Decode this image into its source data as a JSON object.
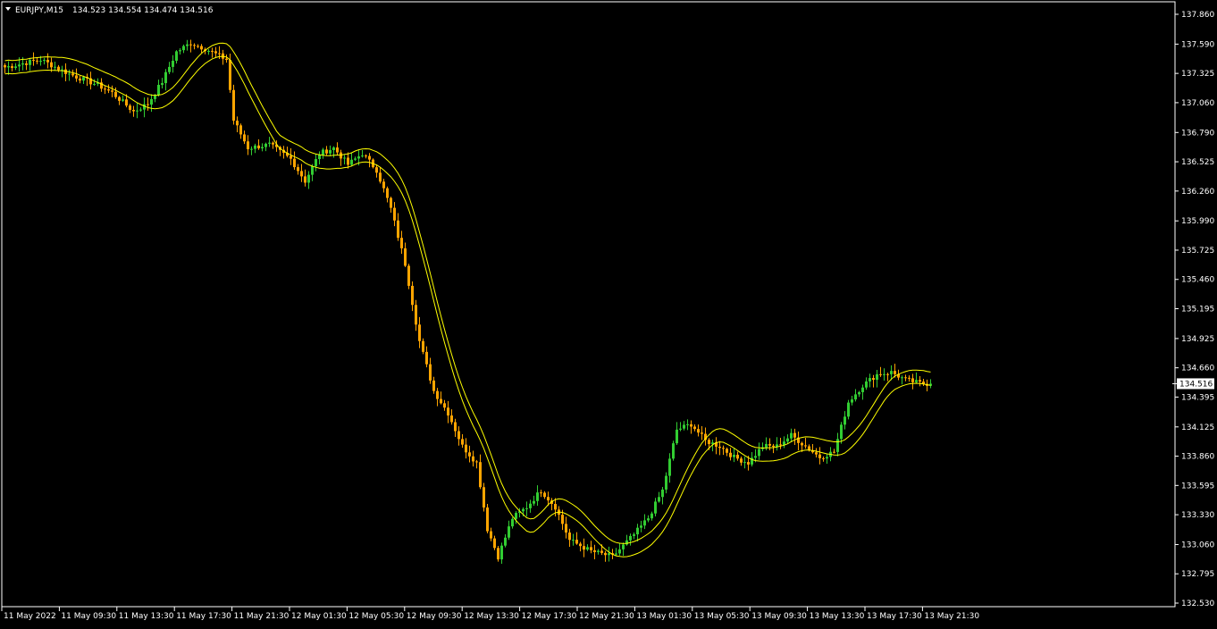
{
  "header": {
    "symbol_timeframe": "EURJPY,M15",
    "ohlc": "134.523 134.554 134.474 134.516"
  },
  "colors": {
    "background": "#000000",
    "frame": "#ffffff",
    "bull": "#32cd32",
    "bear": "#ffa500",
    "envelope": "#ffff00",
    "price_label_bg": "#ffffff",
    "price_label_fg": "#000000"
  },
  "chart_data": {
    "type": "candlestick",
    "title": "EURJPY,M15",
    "y_ticks": [
      "137.860",
      "137.590",
      "137.325",
      "137.060",
      "136.790",
      "136.525",
      "136.260",
      "135.990",
      "135.725",
      "135.460",
      "135.195",
      "134.925",
      "134.660",
      "134.395",
      "134.125",
      "133.860",
      "133.595",
      "133.330",
      "133.060",
      "132.795",
      "132.530"
    ],
    "x_ticks": [
      "11 May 2022",
      "11 May 09:30",
      "11 May 13:30",
      "11 May 17:30",
      "11 May 21:30",
      "12 May 01:30",
      "12 May 05:30",
      "12 May 09:30",
      "12 May 13:30",
      "12 May 17:30",
      "12 May 21:30",
      "13 May 01:30",
      "13 May 05:30",
      "13 May 09:30",
      "13 May 13:30",
      "13 May 17:30",
      "13 May 21:30"
    ],
    "ylim": [
      132.53,
      137.86
    ],
    "current_price": "134.516",
    "grid": false,
    "candle_count": 260,
    "path_anchors": [
      [
        0,
        137.38
      ],
      [
        10,
        137.45
      ],
      [
        18,
        137.32
      ],
      [
        26,
        137.22
      ],
      [
        30,
        137.15
      ],
      [
        36,
        136.98
      ],
      [
        40,
        137.05
      ],
      [
        44,
        137.25
      ],
      [
        48,
        137.52
      ],
      [
        52,
        137.6
      ],
      [
        56,
        137.55
      ],
      [
        62,
        137.45
      ],
      [
        64,
        136.9
      ],
      [
        68,
        136.65
      ],
      [
        74,
        136.68
      ],
      [
        80,
        136.55
      ],
      [
        84,
        136.35
      ],
      [
        88,
        136.6
      ],
      [
        92,
        136.65
      ],
      [
        96,
        136.5
      ],
      [
        100,
        136.6
      ],
      [
        104,
        136.45
      ],
      [
        108,
        136.1
      ],
      [
        112,
        135.6
      ],
      [
        116,
        134.9
      ],
      [
        120,
        134.45
      ],
      [
        124,
        134.25
      ],
      [
        128,
        133.95
      ],
      [
        132,
        133.8
      ],
      [
        135,
        133.2
      ],
      [
        138,
        132.95
      ],
      [
        142,
        133.3
      ],
      [
        146,
        133.4
      ],
      [
        150,
        133.55
      ],
      [
        154,
        133.4
      ],
      [
        158,
        133.1
      ],
      [
        164,
        133.0
      ],
      [
        170,
        132.95
      ],
      [
        176,
        133.15
      ],
      [
        180,
        133.3
      ],
      [
        184,
        133.55
      ],
      [
        188,
        134.1
      ],
      [
        192,
        134.15
      ],
      [
        196,
        134.0
      ],
      [
        200,
        133.95
      ],
      [
        204,
        133.85
      ],
      [
        208,
        133.8
      ],
      [
        212,
        133.95
      ],
      [
        216,
        133.95
      ],
      [
        220,
        134.05
      ],
      [
        224,
        133.95
      ],
      [
        228,
        133.85
      ],
      [
        232,
        133.9
      ],
      [
        236,
        134.35
      ],
      [
        240,
        134.5
      ],
      [
        244,
        134.6
      ],
      [
        248,
        134.62
      ],
      [
        252,
        134.55
      ],
      [
        256,
        134.52
      ],
      [
        259,
        134.516
      ]
    ]
  }
}
